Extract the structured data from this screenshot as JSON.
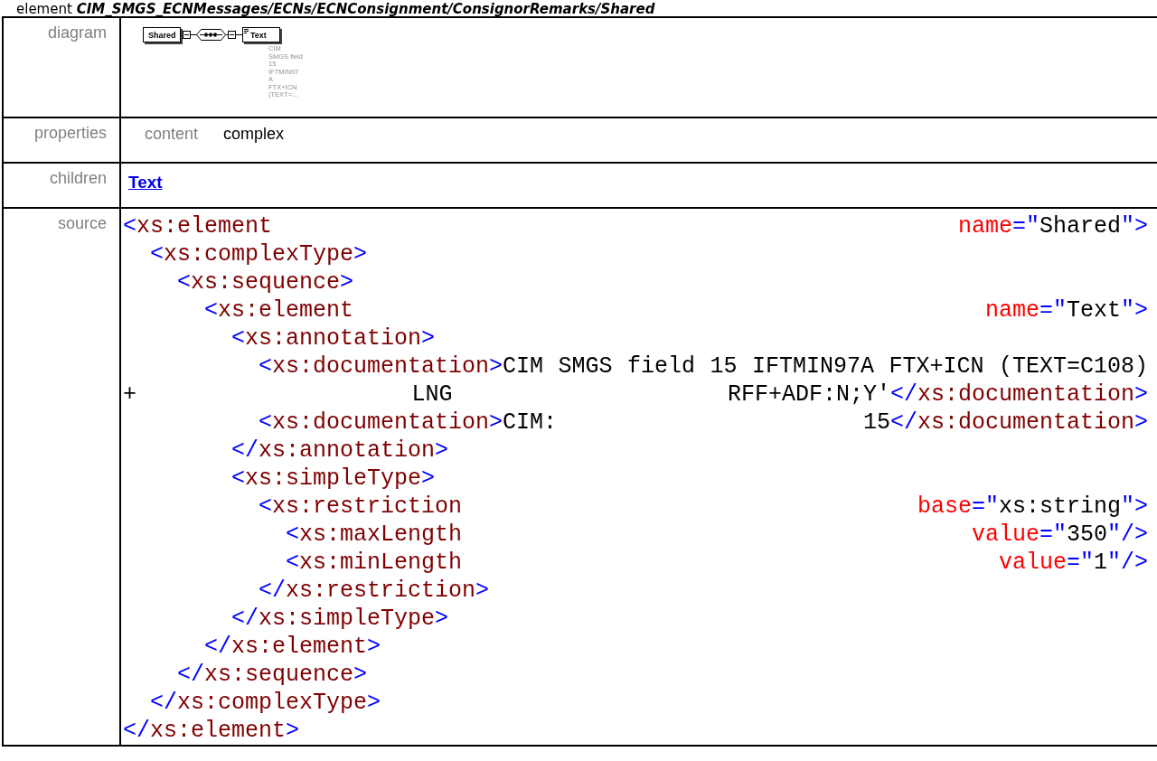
{
  "heading": {
    "prefix": "element",
    "path": "CIM_SMGS_ECNMessages/ECNs/ECNConsignment/ConsignorRemarks/Shared"
  },
  "rows": [
    {
      "kind": "diagram",
      "label": "diagram",
      "diagram": {
        "parent": "Shared",
        "child": "Text",
        "annotation_lines": [
          "CIM",
          "SMGS field",
          "15",
          "IFTMIN97",
          "A",
          "FTX+ICN",
          "(TEXT=..."
        ]
      }
    },
    {
      "kind": "properties",
      "label": "properties",
      "properties": [
        {
          "name": "content",
          "value": "complex"
        }
      ]
    },
    {
      "kind": "children",
      "label": "children",
      "links": [
        "Text"
      ]
    },
    {
      "kind": "source",
      "label": "source",
      "lines": [
        [
          "<xs:element",
          "name=\"Shared\">"
        ],
        [
          "  <xs:complexType>"
        ],
        [
          "    <xs:sequence>"
        ],
        [
          "      <xs:element",
          "name=\"Text\">"
        ],
        [
          "        <xs:annotation>"
        ],
        [
          "          <xs:documentation>CIM",
          "SMGS",
          "field",
          "15",
          "IFTMIN97A",
          "FTX+ICN",
          "(TEXT=C108)"
        ],
        [
          "+",
          "LNG",
          "RFF+ADF:N;Y'</xs:documentation>"
        ],
        [
          "          <xs:documentation>CIM:",
          "15</xs:documentation>"
        ],
        [
          "        </xs:annotation>"
        ],
        [
          "        <xs:simpleType>"
        ],
        [
          "          <xs:restriction",
          "base=\"xs:string\">"
        ],
        [
          "            <xs:maxLength",
          "value=\"350\"/>"
        ],
        [
          "            <xs:minLength",
          "value=\"1\"/>"
        ],
        [
          "          </xs:restriction>"
        ],
        [
          "        </xs:simpleType>"
        ],
        [
          "      </xs:element>"
        ],
        [
          "    </xs:sequence>"
        ],
        [
          "  </xs:complexType>"
        ],
        [
          "</xs:element>"
        ]
      ]
    }
  ]
}
